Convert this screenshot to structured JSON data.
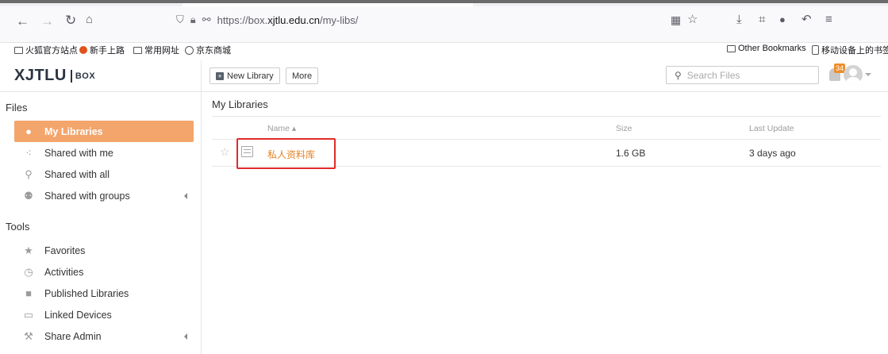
{
  "browser": {
    "url_prefix": "https://box.",
    "url_domain": "xjtlu.edu.cn",
    "url_path": "/my-libs/",
    "bookmarks": [
      {
        "label": "火狐官方站点",
        "icon": "folder-icon"
      },
      {
        "label": "新手上路",
        "icon": "firefox-icon"
      },
      {
        "label": "常用网址",
        "icon": "folder-icon"
      },
      {
        "label": "京东商城",
        "icon": "globe-icon"
      }
    ],
    "bookmarks_right": [
      {
        "label": "Other Bookmarks",
        "icon": "folder-icon"
      },
      {
        "label": "移动设备上的书签",
        "icon": "mobile-icon"
      }
    ]
  },
  "app": {
    "logo_text": "XJTLU",
    "logo_suffix": "BOX",
    "toolbar": {
      "new_library": "New Library",
      "more": "More"
    },
    "search_placeholder": "Search Files",
    "notification_count": "34"
  },
  "sidebar": {
    "files_title": "Files",
    "files_items": [
      {
        "label": "My Libraries",
        "icon": "user-icon",
        "active": true
      },
      {
        "label": "Shared with me",
        "icon": "share-icon"
      },
      {
        "label": "Shared with all",
        "icon": "org-icon"
      },
      {
        "label": "Shared with groups",
        "icon": "group-icon"
      }
    ],
    "tools_title": "Tools",
    "tools_items": [
      {
        "label": "Favorites",
        "icon": "star-icon"
      },
      {
        "label": "Activities",
        "icon": "history-icon"
      },
      {
        "label": "Published Libraries",
        "icon": "book-icon"
      },
      {
        "label": "Linked Devices",
        "icon": "monitor-icon"
      },
      {
        "label": "Share Admin",
        "icon": "wrench-icon"
      }
    ]
  },
  "main": {
    "title": "My Libraries",
    "columns": {
      "name": "Name ▴",
      "size": "Size",
      "updated": "Last Update"
    },
    "rows": [
      {
        "name": "私人资料库",
        "size": "1.6 GB",
        "updated": "3 days ago"
      }
    ]
  }
}
